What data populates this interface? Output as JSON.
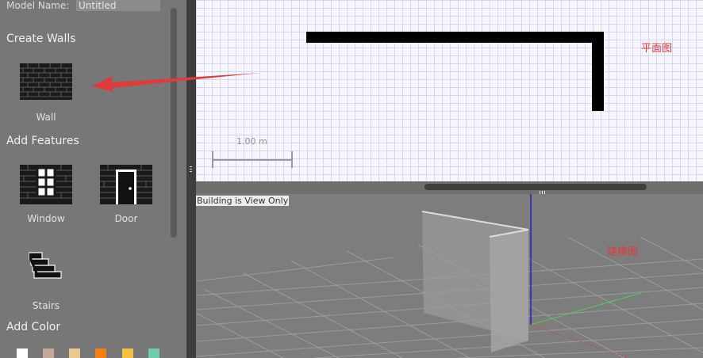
{
  "model": {
    "label": "Model Name:",
    "value": "Untitled"
  },
  "sections": {
    "create_walls": "Create Walls",
    "add_features": "Add Features",
    "add_color": "Add Color"
  },
  "tools": {
    "wall": "Wall",
    "window": "Window",
    "door": "Door",
    "stairs": "Stairs"
  },
  "colors": [
    "#ffffff",
    "#c4a99a",
    "#e9c98e",
    "#f47f14",
    "#f4c242",
    "#6ecbb0"
  ],
  "plan": {
    "scale_label": "1.00 m",
    "annotation": "平面图"
  },
  "model_view": {
    "status": "Building is View Only",
    "annotation": "建模图"
  },
  "accent": {
    "arrow": "#e03a3a"
  }
}
